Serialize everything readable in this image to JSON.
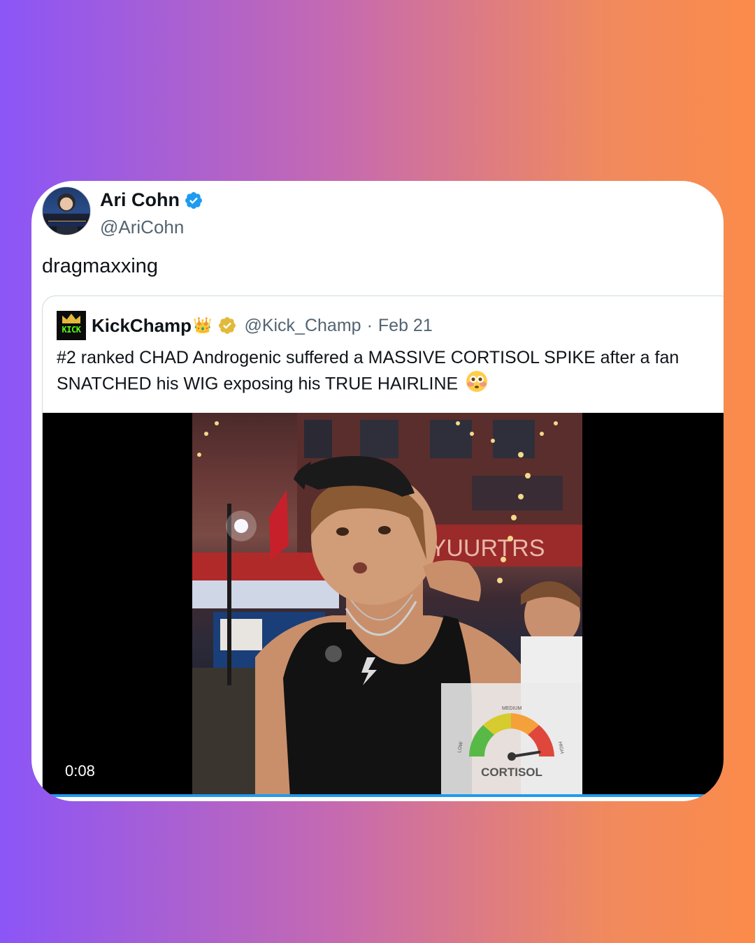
{
  "tweet": {
    "author": {
      "display_name": "Ari Cohn",
      "handle": "@AriCohn",
      "verified_color": "#1d9bf0",
      "avatar_icon": "profile-photo"
    },
    "text": "dragmaxxing"
  },
  "quoted_tweet": {
    "author": {
      "display_name": "KickChamp",
      "crown_emoji": "👑",
      "handle": "@Kick_Champ",
      "verified_color": "#e2b93b",
      "avatar_text": "KICK"
    },
    "separator": "·",
    "date": "Feb 21",
    "text": "#2 ranked CHAD Androgenic suffered a MASSIVE CORTISOL SPIKE after a fan SNATCHED his WIG exposing his TRUE HAIRLINE",
    "emoji": "😳",
    "video": {
      "elapsed": "0:08",
      "progress_color": "#1d9bf0",
      "overlay": {
        "sign_text": "EYUURTRS",
        "gauge": {
          "title": "CORTISOL",
          "low": "LOW",
          "medium": "MEDIUM",
          "high": "HIGH",
          "level": 0.95
        }
      }
    }
  },
  "colors": {
    "background_start": "#8b55f7",
    "background_end": "#fb8b4a",
    "text_primary": "#0f1419",
    "text_secondary": "#536471"
  }
}
